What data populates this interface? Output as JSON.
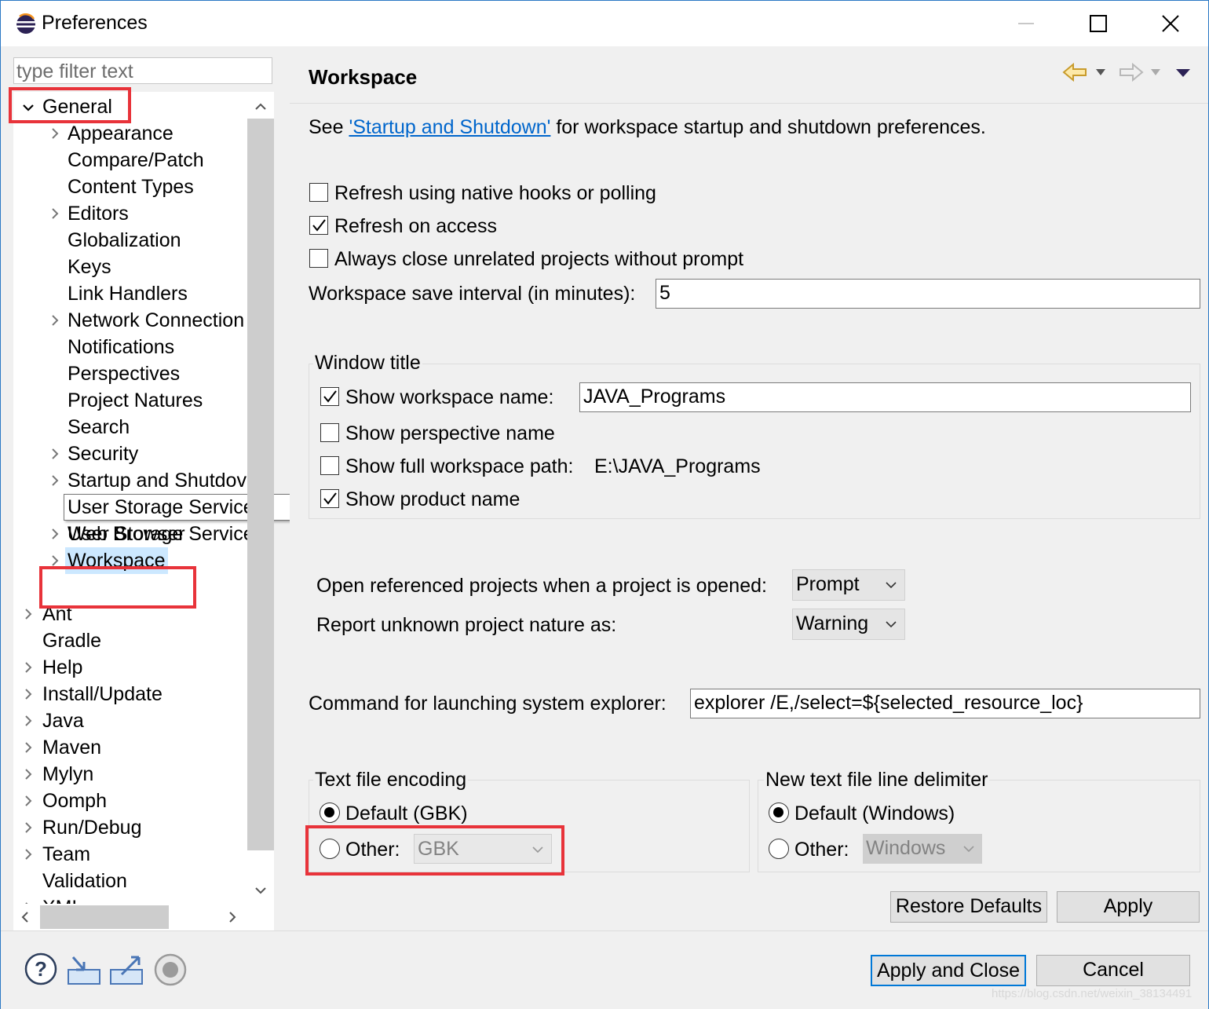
{
  "window": {
    "title": "Preferences"
  },
  "filter": {
    "placeholder": "type filter text"
  },
  "tree": {
    "general": "General",
    "general_children": [
      "Appearance",
      "Compare/Patch",
      "Content Types",
      "Editors",
      "Globalization",
      "Keys",
      "Link Handlers",
      "Network Connection",
      "Notifications",
      "Perspectives",
      "Project Natures",
      "Search",
      "Security",
      "Startup and Shutdov",
      "User Storage Service",
      "Web Browser",
      "Workspace"
    ],
    "tooltip": "User Storage Service",
    "top_items": [
      "Ant",
      "Gradle",
      "Help",
      "Install/Update",
      "Java",
      "Maven",
      "Mylyn",
      "Oomph",
      "Run/Debug",
      "Team",
      "Validation",
      "XML"
    ]
  },
  "page": {
    "title": "Workspace",
    "intro_prefix": "See ",
    "intro_link": "'Startup and Shutdown'",
    "intro_suffix": " for workspace startup and shutdown preferences.",
    "refresh_native": "Refresh using native hooks or polling",
    "refresh_access": "Refresh on access",
    "always_close": "Always close unrelated projects without prompt",
    "save_interval_label": "Workspace save interval (in minutes):",
    "save_interval_value": "5",
    "window_title_group": "Window title",
    "show_ws_name": "Show workspace name:",
    "ws_name_value": "JAVA_Programs",
    "show_persp": "Show perspective name",
    "show_full_path": "Show full workspace path:",
    "full_path_value": "E:\\JAVA_Programs",
    "show_product": "Show product name",
    "open_ref_label": "Open referenced projects when a project is opened:",
    "open_ref_value": "Prompt",
    "report_label": "Report unknown project nature as:",
    "report_value": "Warning",
    "explorer_label": "Command for launching system explorer:",
    "explorer_value": "explorer /E,/select=${selected_resource_loc}",
    "encoding_group": "Text file encoding",
    "enc_default": "Default (GBK)",
    "enc_other": "Other:",
    "enc_other_value": "GBK",
    "delim_group": "New text file line delimiter",
    "delim_default": "Default (Windows)",
    "delim_other": "Other:",
    "delim_other_value": "Windows",
    "restore_defaults": "Restore Defaults",
    "apply": "Apply"
  },
  "footer": {
    "apply_close": "Apply and Close",
    "cancel": "Cancel"
  },
  "watermark": "https://blog.csdn.net/weixin_38134491",
  "colors": {
    "accent": "#0078d7",
    "highlight": "#e8333a",
    "link": "#0066cc",
    "selection": "#cce8ff"
  }
}
